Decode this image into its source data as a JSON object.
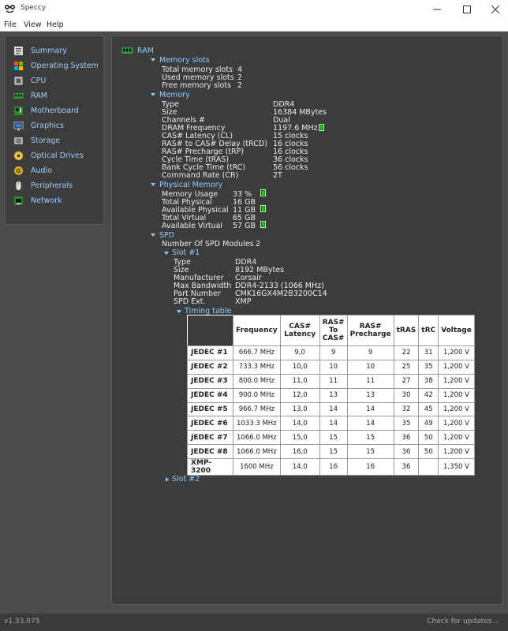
{
  "window": {
    "title": "Speccy"
  },
  "menu": {
    "items": [
      "File",
      "View",
      "Help"
    ]
  },
  "sidebar": {
    "items": [
      {
        "label": "Summary",
        "icon": "summary-icon"
      },
      {
        "label": "Operating System",
        "icon": "windows-logo-icon"
      },
      {
        "label": "CPU",
        "icon": "cpu-icon"
      },
      {
        "label": "RAM",
        "icon": "ram-icon"
      },
      {
        "label": "Motherboard",
        "icon": "motherboard-icon"
      },
      {
        "label": "Graphics",
        "icon": "graphics-icon"
      },
      {
        "label": "Storage",
        "icon": "storage-icon"
      },
      {
        "label": "Optical Drives",
        "icon": "optical-drive-icon"
      },
      {
        "label": "Audio",
        "icon": "audio-icon"
      },
      {
        "label": "Peripherals",
        "icon": "mouse-icon"
      },
      {
        "label": "Network",
        "icon": "network-icon"
      }
    ]
  },
  "ram": {
    "header": "RAM",
    "memory_slots": {
      "label": "Memory slots",
      "rows": [
        {
          "k": "Total memory slots",
          "v": "4"
        },
        {
          "k": "Used memory slots",
          "v": "2"
        },
        {
          "k": "Free memory slots",
          "v": "2"
        }
      ]
    },
    "memory": {
      "label": "Memory",
      "rows": [
        {
          "k": "Type",
          "v": "DDR4"
        },
        {
          "k": "Size",
          "v": "16384 MBytes"
        },
        {
          "k": "Channels #",
          "v": "Dual"
        },
        {
          "k": "DRAM Frequency",
          "v": "1197.6 MHz"
        },
        {
          "k": "CAS# Latency (CL)",
          "v": "15 clocks"
        },
        {
          "k": "RAS# to CAS# Delay (tRCD)",
          "v": "16 clocks"
        },
        {
          "k": "RAS# Precharge (tRP)",
          "v": "16 clocks"
        },
        {
          "k": "Cycle Time (tRAS)",
          "v": "36 clocks"
        },
        {
          "k": "Bank Cycle Time (tRC)",
          "v": "56 clocks"
        },
        {
          "k": "Command Rate (CR)",
          "v": "2T"
        }
      ]
    },
    "physical": {
      "label": "Physical Memory",
      "rows": [
        {
          "k": "Memory Usage",
          "v": "33 %"
        },
        {
          "k": "Total Physical",
          "v": "16 GB"
        },
        {
          "k": "Available Physical",
          "v": "11 GB"
        },
        {
          "k": "Total Virtual",
          "v": "65 GB"
        },
        {
          "k": "Available Virtual",
          "v": "57 GB"
        }
      ]
    },
    "spd": {
      "label": "SPD",
      "modules_label": "Number Of SPD Modules",
      "modules_value": "2",
      "slot1": {
        "label": "Slot #1",
        "rows": [
          {
            "k": "Type",
            "v": "DDR4"
          },
          {
            "k": "Size",
            "v": "8192 MBytes"
          },
          {
            "k": "Manufacturer",
            "v": "Corsair"
          },
          {
            "k": "Max Bandwidth",
            "v": "DDR4-2133 (1066 MHz)"
          },
          {
            "k": "Part Number",
            "v": "CMK16GX4M2B3200C14"
          },
          {
            "k": "SPD Ext.",
            "v": "XMP"
          }
        ],
        "timing_label": "Timing table"
      },
      "slot2": {
        "label": "Slot #2"
      }
    }
  },
  "timing_table": {
    "headers": [
      "Frequency",
      "CAS#\nLatency",
      "RAS#\nTo\nCAS#",
      "RAS#\nPrecharge",
      "tRAS",
      "tRC",
      "Voltage"
    ],
    "rows": [
      [
        "JEDEC #1",
        "666.7 MHz",
        "9,0",
        "9",
        "9",
        "22",
        "31",
        "1,200 V"
      ],
      [
        "JEDEC #2",
        "733.3 MHz",
        "10,0",
        "10",
        "10",
        "25",
        "35",
        "1,200 V"
      ],
      [
        "JEDEC #3",
        "800.0 MHz",
        "11,0",
        "11",
        "11",
        "27",
        "38",
        "1,200 V"
      ],
      [
        "JEDEC #4",
        "900.0 MHz",
        "12,0",
        "13",
        "13",
        "30",
        "42",
        "1,200 V"
      ],
      [
        "JEDEC #5",
        "966.7 MHz",
        "13,0",
        "14",
        "14",
        "32",
        "45",
        "1,200 V"
      ],
      [
        "JEDEC #6",
        "1033.3 MHz",
        "14,0",
        "14",
        "14",
        "35",
        "49",
        "1,200 V"
      ],
      [
        "JEDEC #7",
        "1066.0 MHz",
        "15,0",
        "15",
        "15",
        "36",
        "50",
        "1,200 V"
      ],
      [
        "JEDEC #8",
        "1066.0 MHz",
        "16,0",
        "15",
        "15",
        "36",
        "50",
        "1,200 V"
      ],
      [
        "XMP-3200",
        "1600 MHz",
        "14,0",
        "16",
        "16",
        "36",
        "",
        "1,350 V"
      ]
    ]
  },
  "status": {
    "version": "v1.33.075",
    "update_link": "Check for updates..."
  },
  "colors": {
    "accent": "#8ecbff",
    "indicator": "#16d60e",
    "panel": "#3c3c3c",
    "background": "#4b4b4b"
  }
}
